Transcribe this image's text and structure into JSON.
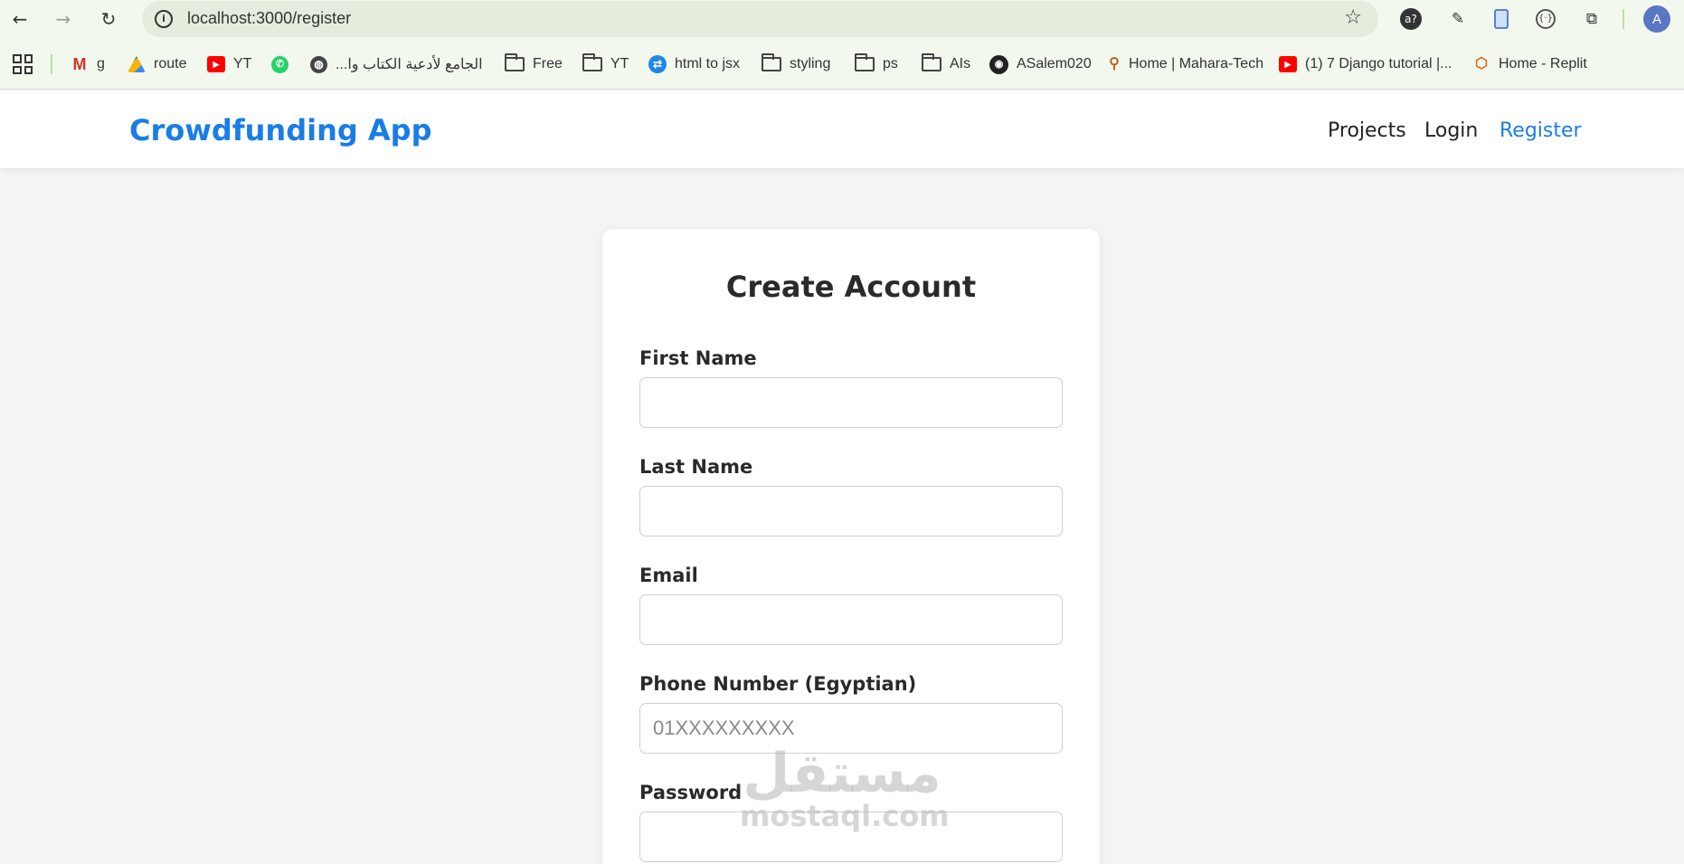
{
  "browser": {
    "url": "localhost:3000/register",
    "avatar_letter": "A",
    "bookmarks": [
      {
        "label": "g",
        "icon": "gmail-icon"
      },
      {
        "label": "route",
        "icon": "drive-icon"
      },
      {
        "label": "YT",
        "icon": "youtube-icon"
      },
      {
        "label": "",
        "icon": "whatsapp-icon"
      },
      {
        "label": "الجامع لأدعية الكتاب وا...",
        "icon": "globe-icon"
      },
      {
        "label": "Free",
        "icon": "folder-icon"
      },
      {
        "label": "YT",
        "icon": "folder-icon"
      },
      {
        "label": "html to jsx",
        "icon": "transform-icon"
      },
      {
        "label": "styling",
        "icon": "folder-icon"
      },
      {
        "label": "ps",
        "icon": "folder-icon"
      },
      {
        "label": "AIs",
        "icon": "folder-icon"
      },
      {
        "label": "ASalem020",
        "icon": "github-icon"
      },
      {
        "label": "Home | Mahara-Tech",
        "icon": "mahara-icon"
      },
      {
        "label": "(1) 7 Django tutorial |...",
        "icon": "youtube-icon"
      },
      {
        "label": "Home - Replit",
        "icon": "replit-icon"
      }
    ]
  },
  "app": {
    "brand": "Crowdfunding App",
    "nav": {
      "projects": "Projects",
      "login": "Login",
      "register": "Register"
    }
  },
  "form": {
    "title": "Create Account",
    "first_name_label": "First Name",
    "last_name_label": "Last Name",
    "email_label": "Email",
    "phone_label": "Phone Number (Egyptian)",
    "phone_placeholder": "01XXXXXXXXX",
    "password_label": "Password"
  },
  "watermark": {
    "arabic": "مستقل",
    "latin": "mostaql.com"
  },
  "colors": {
    "accent": "#1a7de6",
    "background": "#f4f4f4",
    "browser_chrome": "#f3f8ee"
  }
}
